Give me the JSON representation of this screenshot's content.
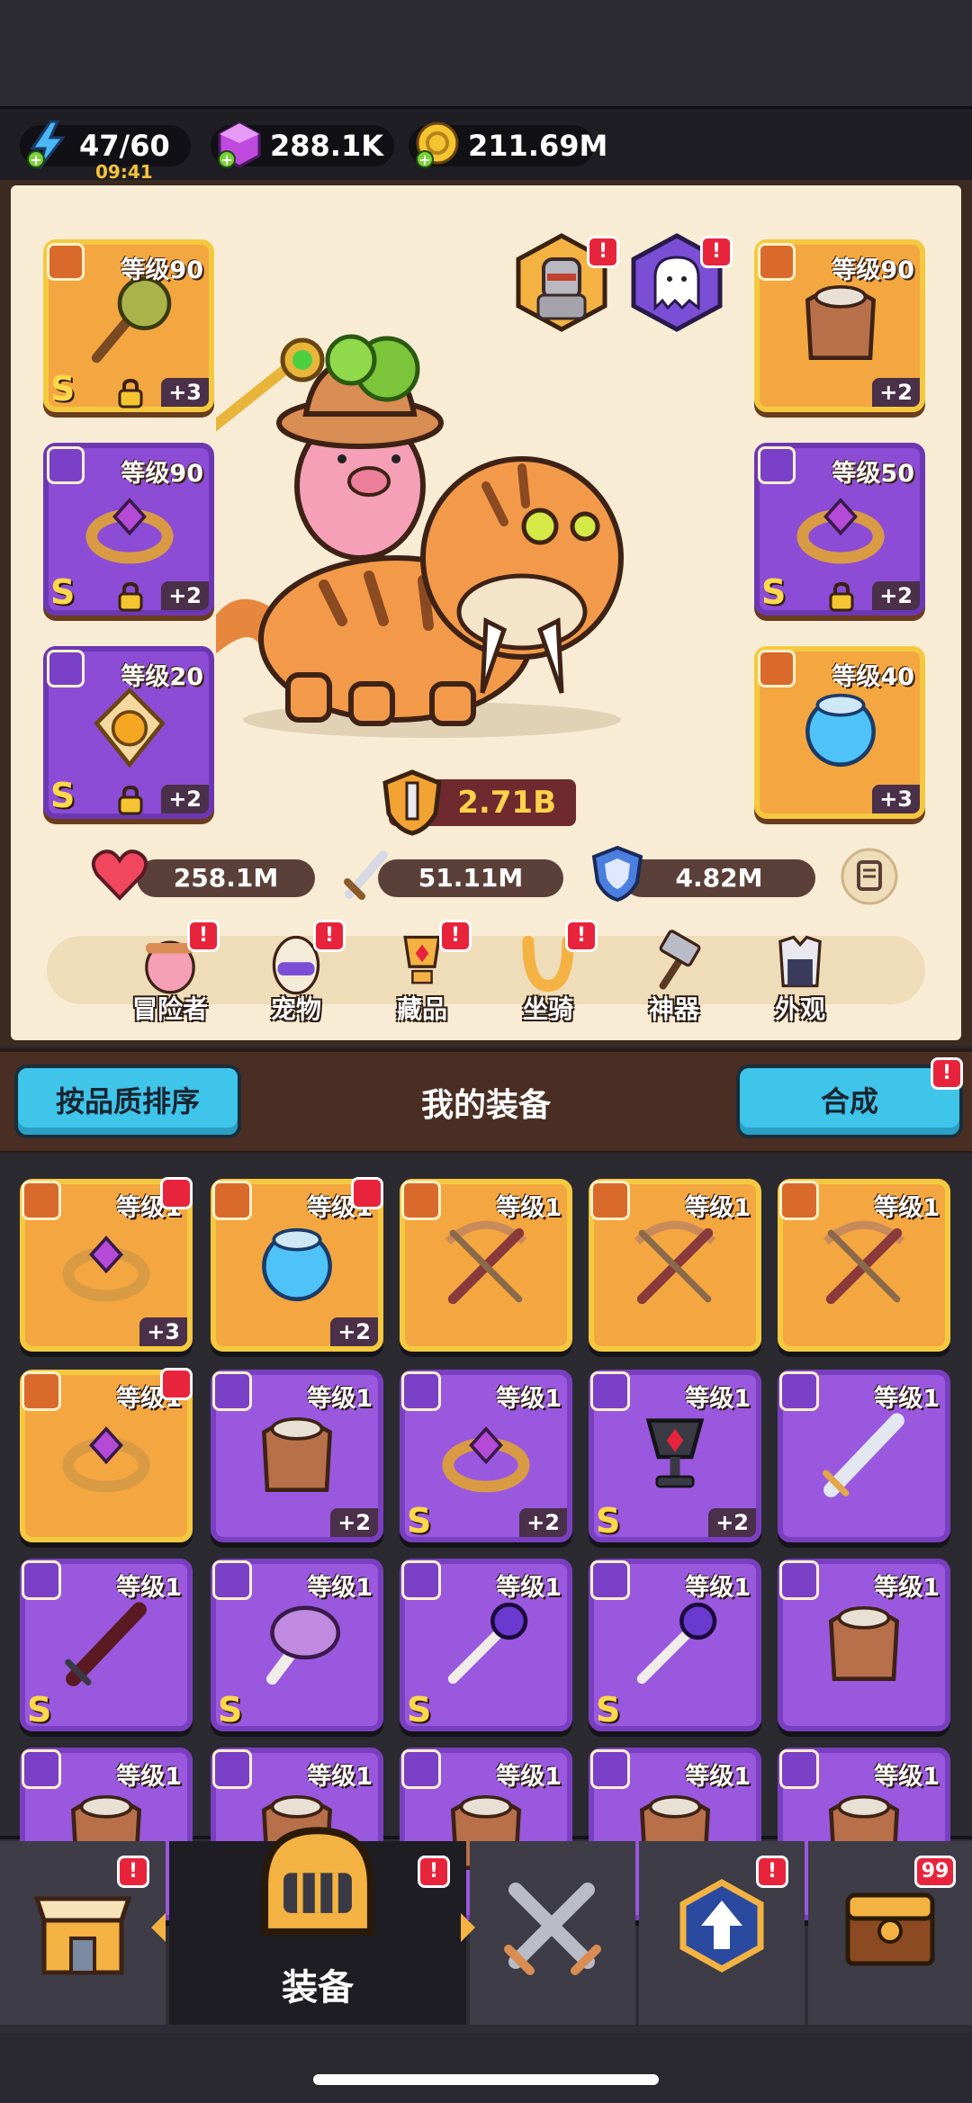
{
  "resources": {
    "energy": {
      "value": "47/60",
      "timer": "09:41",
      "icon": "lightning-icon"
    },
    "gems": {
      "value": "288.1K",
      "icon": "gem-icon"
    },
    "gold": {
      "value": "211.69M",
      "icon": "gold-coin-icon"
    }
  },
  "colors": {
    "gold_slot": "#f4a640",
    "purple_slot": "#8c4cd6",
    "accent_cyan": "#3fc4ea",
    "badge_red": "#e8243c"
  },
  "hero": {
    "left_slots": [
      {
        "level": "等级90",
        "plus": "+3",
        "grade": "S",
        "rarity": "gold",
        "item": "mace-icon",
        "locked": true
      },
      {
        "level": "等级90",
        "plus": "+2",
        "grade": "S",
        "rarity": "purple",
        "item": "ring-icon",
        "locked": true
      },
      {
        "level": "等级20",
        "plus": "+2",
        "grade": "S",
        "rarity": "purple",
        "item": "amulet-icon",
        "locked": true
      }
    ],
    "right_slots": [
      {
        "level": "等级90",
        "plus": "+2",
        "grade": "",
        "rarity": "gold",
        "item": "armor-icon",
        "locked": false
      },
      {
        "level": "等级50",
        "plus": "+2",
        "grade": "S",
        "rarity": "purple",
        "item": "ring-icon",
        "locked": true
      },
      {
        "level": "等级40",
        "plus": "+3",
        "grade": "",
        "rarity": "gold",
        "item": "orb-icon",
        "locked": false
      }
    ],
    "power": "2.71B",
    "stats": {
      "hp": "258.1M",
      "attack": "51.11M",
      "defense": "4.82M"
    },
    "nav": [
      {
        "label": "冒险者",
        "icon": "adventurer-icon",
        "badge": "!"
      },
      {
        "label": "宠物",
        "icon": "pet-egg-icon",
        "badge": "!"
      },
      {
        "label": "藏品",
        "icon": "trophy-icon",
        "badge": "!"
      },
      {
        "label": "坐骑",
        "icon": "horseshoe-icon",
        "badge": "!"
      },
      {
        "label": "神器",
        "icon": "hammer-icon",
        "badge": ""
      },
      {
        "label": "外观",
        "icon": "outfit-icon",
        "badge": ""
      }
    ]
  },
  "equipment": {
    "sort_button": "按品质排序",
    "title": "我的装备",
    "merge_button": "合成",
    "merge_badge": "!",
    "items": [
      {
        "level": "等级1",
        "plus": "+3",
        "grade": "",
        "rarity": "gold",
        "item": "ring-icon",
        "up": true
      },
      {
        "level": "等级1",
        "plus": "+2",
        "grade": "",
        "rarity": "gold",
        "item": "orb-icon",
        "up": true
      },
      {
        "level": "等级1",
        "plus": "",
        "grade": "",
        "rarity": "gold",
        "item": "crossbow-icon",
        "up": false
      },
      {
        "level": "等级1",
        "plus": "",
        "grade": "",
        "rarity": "gold",
        "item": "crossbow-icon",
        "up": false
      },
      {
        "level": "等级1",
        "plus": "",
        "grade": "",
        "rarity": "gold",
        "item": "crossbow-icon",
        "up": false
      },
      {
        "level": "等级1",
        "plus": "",
        "grade": "",
        "rarity": "gold",
        "item": "ring-icon",
        "up": true
      },
      {
        "level": "等级1",
        "plus": "+2",
        "grade": "",
        "rarity": "purple",
        "item": "armor-icon",
        "up": false
      },
      {
        "level": "等级1",
        "plus": "+2",
        "grade": "S",
        "rarity": "purple",
        "item": "ring-icon",
        "up": false
      },
      {
        "level": "等级1",
        "plus": "+2",
        "grade": "S",
        "rarity": "purple",
        "item": "goblet-icon",
        "up": false
      },
      {
        "level": "等级1",
        "plus": "",
        "grade": "",
        "rarity": "purple",
        "item": "sword-icon",
        "up": false
      },
      {
        "level": "等级1",
        "plus": "",
        "grade": "S",
        "rarity": "purple",
        "item": "dark-sword-icon",
        "up": false
      },
      {
        "level": "等级1",
        "plus": "",
        "grade": "S",
        "rarity": "purple",
        "item": "mushroom-club-icon",
        "up": false
      },
      {
        "level": "等级1",
        "plus": "",
        "grade": "S",
        "rarity": "purple",
        "item": "bone-staff-icon",
        "up": false
      },
      {
        "level": "等级1",
        "plus": "",
        "grade": "S",
        "rarity": "purple",
        "item": "bone-staff-icon",
        "up": false
      },
      {
        "level": "等级1",
        "plus": "",
        "grade": "",
        "rarity": "purple",
        "item": "armor-icon",
        "up": false
      },
      {
        "level": "等级1",
        "plus": "",
        "grade": "",
        "rarity": "purple",
        "item": "armor-icon",
        "up": false
      },
      {
        "level": "等级1",
        "plus": "",
        "grade": "",
        "rarity": "purple",
        "item": "armor-icon",
        "up": false
      },
      {
        "level": "等级1",
        "plus": "",
        "grade": "",
        "rarity": "purple",
        "item": "armor-icon",
        "up": false
      },
      {
        "level": "等级1",
        "plus": "",
        "grade": "",
        "rarity": "purple",
        "item": "armor-icon",
        "up": false
      },
      {
        "level": "等级1",
        "plus": "",
        "grade": "",
        "rarity": "purple",
        "item": "armor-icon",
        "up": false
      }
    ]
  },
  "bottom_nav": [
    {
      "label": "",
      "icon": "shop-icon",
      "badge": "!"
    },
    {
      "label": "装备",
      "icon": "helmet-icon",
      "badge": "!",
      "active": true
    },
    {
      "label": "",
      "icon": "crossed-swords-icon",
      "badge": ""
    },
    {
      "label": "",
      "icon": "upgrade-icon",
      "badge": "!"
    },
    {
      "label": "",
      "icon": "treasure-chest-icon",
      "badge": "99"
    }
  ]
}
